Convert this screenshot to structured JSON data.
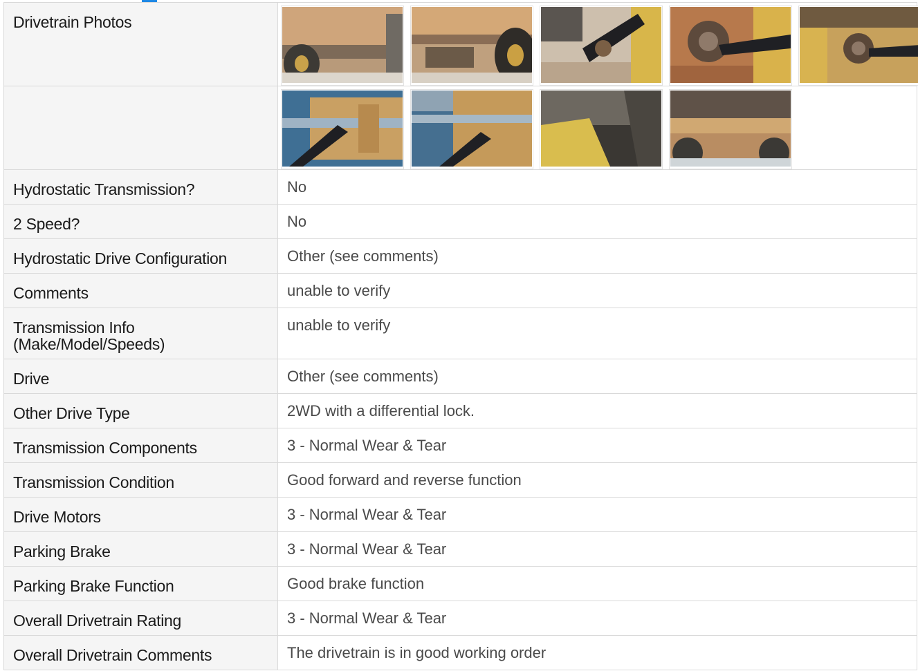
{
  "section": {
    "photos_label": "Drivetrain Photos"
  },
  "photos": {
    "row1": [
      "drivetrain-photo-1",
      "drivetrain-photo-2",
      "drivetrain-photo-3",
      "drivetrain-photo-4",
      "drivetrain-photo-5"
    ],
    "row2": [
      "drivetrain-photo-6",
      "drivetrain-photo-7",
      "drivetrain-photo-8",
      "drivetrain-photo-9"
    ]
  },
  "rows": [
    {
      "label": "Hydrostatic Transmission?",
      "value": "No"
    },
    {
      "label": "2 Speed?",
      "value": "No"
    },
    {
      "label": "Hydrostatic Drive Configuration",
      "value": "Other (see comments)"
    },
    {
      "label": "Comments",
      "value": "unable to verify"
    },
    {
      "label": "Transmission Info (Make/Model/Speeds)",
      "value": "unable to verify"
    },
    {
      "label": "Drive",
      "value": "Other (see comments)"
    },
    {
      "label": "Other Drive Type",
      "value": "2WD with a differential lock."
    },
    {
      "label": "Transmission Components",
      "value": "3 - Normal Wear & Tear"
    },
    {
      "label": "Transmission Condition",
      "value": "Good forward and reverse function"
    },
    {
      "label": "Drive Motors",
      "value": "3 - Normal Wear & Tear"
    },
    {
      "label": "Parking Brake",
      "value": "3 - Normal Wear & Tear"
    },
    {
      "label": "Parking Brake Function",
      "value": "Good brake function"
    },
    {
      "label": "Overall Drivetrain Rating",
      "value": "3 - Normal Wear & Tear"
    },
    {
      "label": "Overall Drivetrain Comments",
      "value": "The drivetrain is in good working order"
    }
  ],
  "colors": {
    "label_bg": "#f5f5f5",
    "border": "#d9d9d9",
    "accent": "#1e88e5"
  }
}
